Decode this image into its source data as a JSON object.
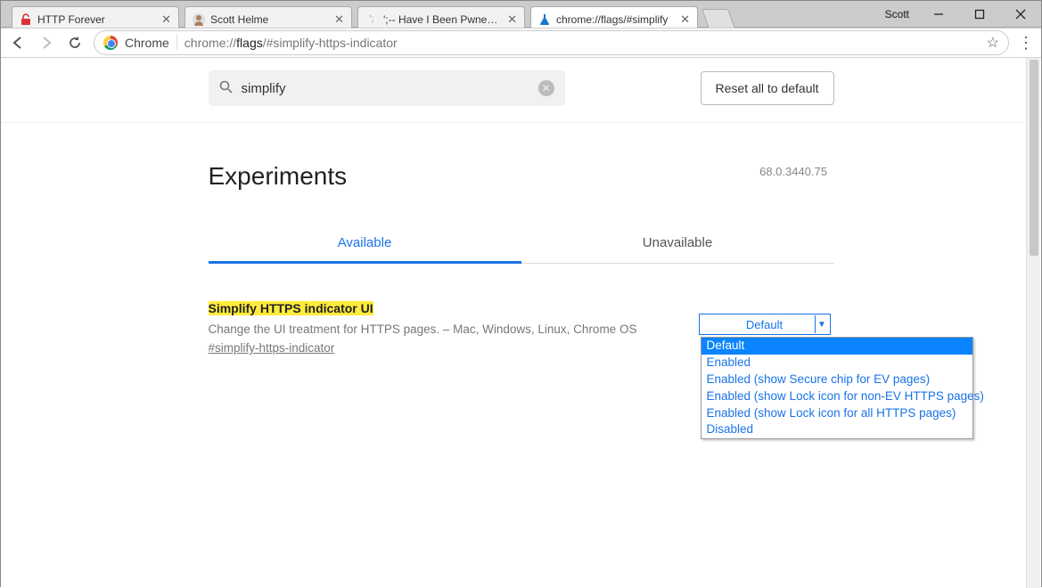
{
  "window": {
    "user": "Scott"
  },
  "tabs": [
    {
      "title": "HTTP Forever",
      "favicon": "lock-open-red"
    },
    {
      "title": "Scott Helme",
      "favicon": "avatar"
    },
    {
      "title": "';-- Have I Been Pwned: Chec",
      "favicon": "text"
    },
    {
      "title": "chrome://flags/#simplify",
      "favicon": "flask",
      "active": true
    }
  ],
  "omnibox": {
    "scheme_label": "Chrome",
    "url_gray_pre": "chrome://",
    "url_dark": "flags",
    "url_gray_post": "/#simplify-https-indicator"
  },
  "search": {
    "value": "simplify"
  },
  "buttons": {
    "reset": "Reset all to default"
  },
  "page": {
    "title": "Experiments",
    "version": "68.0.3440.75"
  },
  "exp_tabs": {
    "available": "Available",
    "unavailable": "Unavailable"
  },
  "flag": {
    "title": "Simplify HTTPS indicator UI",
    "desc": "Change the UI treatment for HTTPS pages. – Mac, Windows, Linux, Chrome OS",
    "hash": "#simplify-https-indicator",
    "selected": "Default",
    "options": [
      "Default",
      "Enabled",
      "Enabled (show Secure chip for EV pages)",
      "Enabled (show Lock icon for non-EV HTTPS pages)",
      "Enabled (show Lock icon for all HTTPS pages)",
      "Disabled"
    ]
  }
}
